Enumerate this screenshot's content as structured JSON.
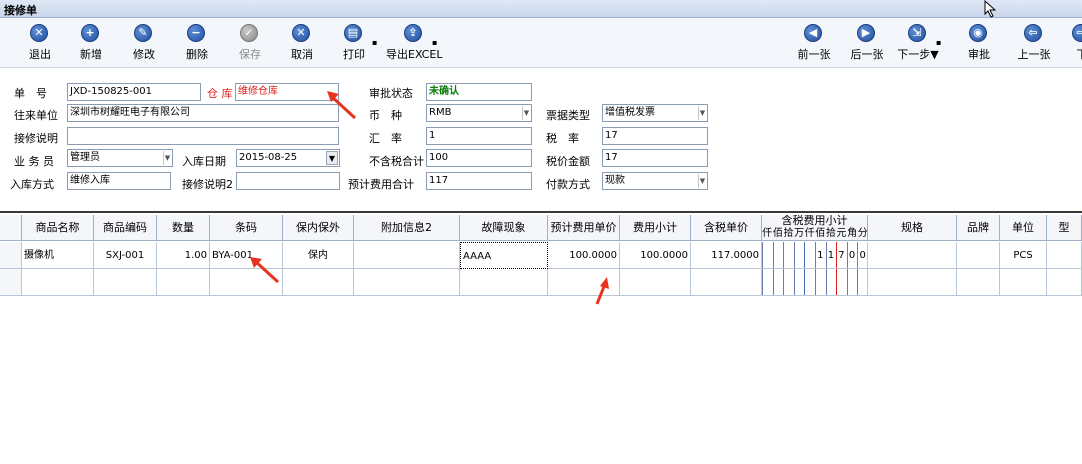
{
  "window": {
    "title": "接修单"
  },
  "toolbar": {
    "left": [
      {
        "label": "退出",
        "icon": "exit-icon",
        "glyph": "✕"
      },
      {
        "label": "新增",
        "icon": "add-icon",
        "glyph": "+"
      },
      {
        "label": "修改",
        "icon": "edit-icon",
        "glyph": "✎"
      },
      {
        "label": "删除",
        "icon": "delete-icon",
        "glyph": "−"
      },
      {
        "label": "保存",
        "icon": "save-icon",
        "glyph": "✓",
        "disabled": true
      },
      {
        "label": "取消",
        "icon": "cancel-icon",
        "glyph": "✕"
      },
      {
        "label": "打印",
        "icon": "print-icon",
        "glyph": "▤"
      },
      {
        "label": "导出EXCEL",
        "icon": "export-excel-icon",
        "glyph": "⇪"
      }
    ],
    "right": [
      {
        "label": "前一张",
        "icon": "previous-icon",
        "glyph": "◀"
      },
      {
        "label": "后一张",
        "icon": "next-icon",
        "glyph": "▶"
      },
      {
        "label": "下一步▼",
        "icon": "next-step-icon",
        "glyph": "⇲"
      },
      {
        "label": "审批",
        "icon": "approve-icon",
        "glyph": "◉"
      },
      {
        "label": "上一张",
        "icon": "up-icon",
        "glyph": "⇦"
      },
      {
        "label": "下",
        "icon": "down-icon",
        "glyph": "⇨"
      }
    ]
  },
  "form": {
    "order_no_label": "单　号",
    "order_no": "JXD-150825-001",
    "warehouse_label": "仓 库",
    "warehouse": "维修仓库",
    "approval_label": "审批状态",
    "approval": "未确认",
    "partner_label": "往来单位",
    "partner": "深圳市树耀旺电子有限公司",
    "currency_label": "币　种",
    "currency": "RMB",
    "invoice_type_label": "票据类型",
    "invoice_type": "增值税发票",
    "repair_note_label": "接修说明",
    "repair_note": "",
    "rate_label": "汇　率",
    "rate": "1",
    "tax_label": "税　率",
    "tax": "17",
    "staff_label": "业 务 员",
    "staff": "管理员",
    "date_label": "入库日期",
    "date": "2015-08-25",
    "net_total_label": "不含税合计",
    "net_total": "100",
    "tax_amount_label": "税价金额",
    "tax_amount": "17",
    "entry_mode_label": "入库方式",
    "entry_mode": "维修入库",
    "repair_note2_label": "接修说明2",
    "repair_note2": "",
    "estimate_total_label": "预计费用合计",
    "estimate_total": "117",
    "payment_label": "付款方式",
    "payment": "现款"
  },
  "grid": {
    "columns": [
      "商品名称",
      "商品编码",
      "数量",
      "条码",
      "保内保外",
      "附加信息2",
      "故障现象",
      "预计费用单价",
      "费用小计",
      "含税单价",
      "含税费用小计",
      "规格",
      "品牌",
      "单位",
      "型"
    ],
    "digit_headers": [
      "仟",
      "佰",
      "拾",
      "万",
      "仟",
      "佰",
      "拾",
      "元",
      "角",
      "分"
    ],
    "rows": [
      {
        "name": "摄像机",
        "code": "SXJ-001",
        "qty": "1.00",
        "barcode": "BYA-001",
        "warranty": "保内",
        "extra": "",
        "fault": "AAAA",
        "unit_price": "100.0000",
        "subtotal": "100.0000",
        "tax_price": "117.0000",
        "tax_digits": [
          "",
          "",
          "",
          "",
          "",
          "1",
          "1",
          "7",
          "0",
          "0"
        ],
        "spec": "",
        "brand": "",
        "unit": "PCS",
        "model": ""
      }
    ]
  },
  "colors": {
    "accent_red": "#e0201c",
    "approval_green": "#0a7d0a",
    "grid_line": "#b9c6d8"
  }
}
